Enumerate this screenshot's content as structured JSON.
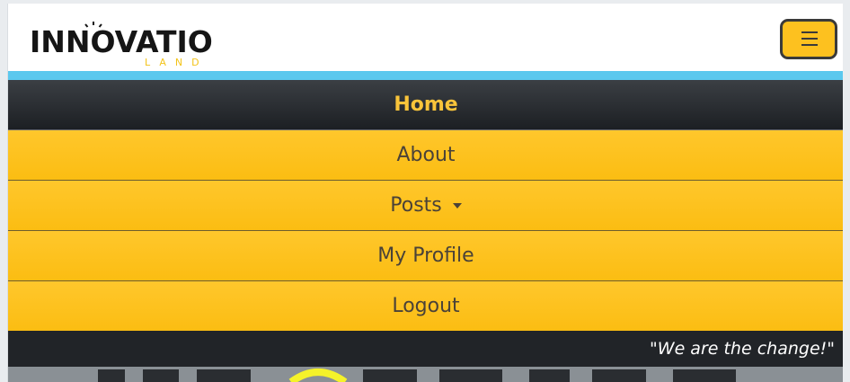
{
  "brand": {
    "logo_top_text": "INNOVATION",
    "logo_sub_text": "LAND",
    "colors": {
      "dark": "#151515",
      "accent": "#f3c319"
    }
  },
  "toggler": {
    "icon": "hamburger-menu-icon",
    "color": "#fdc11f"
  },
  "nav": {
    "items": [
      {
        "label": "Home",
        "active": true
      },
      {
        "label": "About"
      },
      {
        "label": "Posts",
        "dropdown": true,
        "dropdown_icon": "caret-down-icon"
      },
      {
        "label": "My Profile"
      },
      {
        "label": "Logout"
      }
    ],
    "colors": {
      "item_bg": "#fdc11f",
      "active_bg": "#212428",
      "active_text": "#f9c43a",
      "accent_line": "#5bc8ee"
    }
  },
  "tagline": "\"We are the change!\""
}
